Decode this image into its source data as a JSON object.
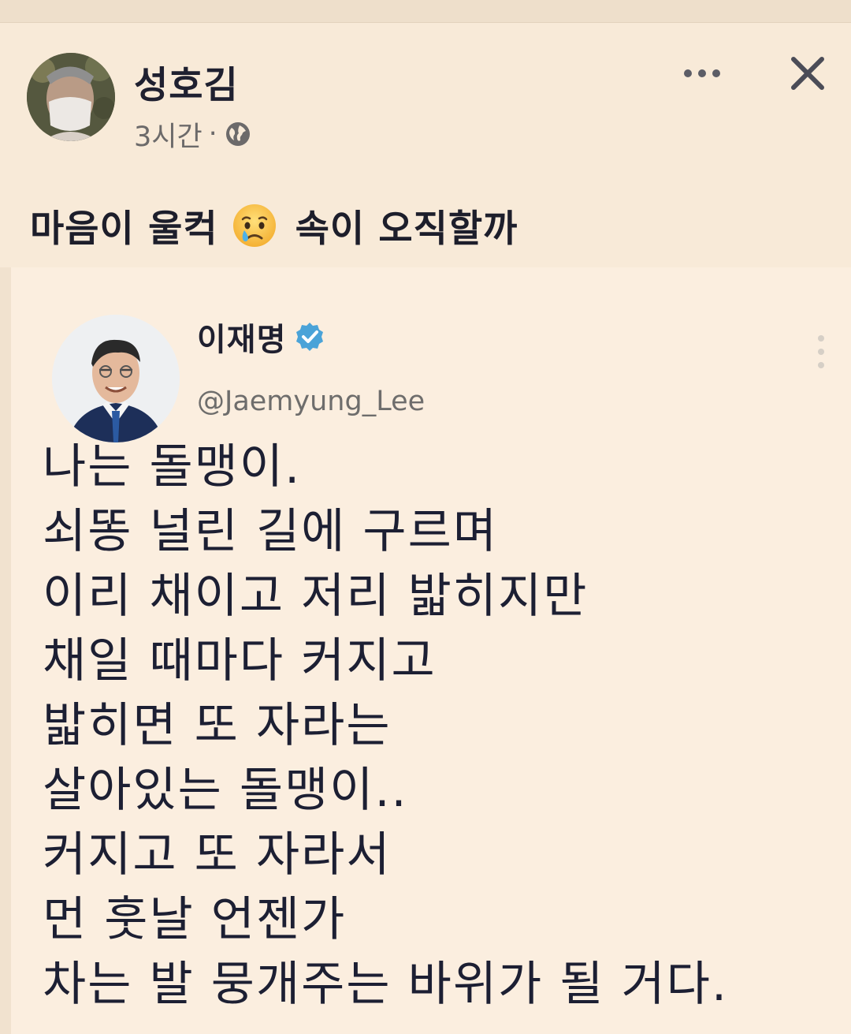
{
  "post": {
    "author": "성호김",
    "time": "3시간",
    "separator": "·",
    "text_before_emoji": "마음이 울컥",
    "text_after_emoji": "속이 오직할까"
  },
  "tweet": {
    "name": "이재명",
    "handle": "@Jaemyung_Lee",
    "lines": [
      "나는 돌맹이.",
      "쇠똥 널린 길에 구르며",
      "이리 채이고 저리 밟히지만",
      "채일 때마다 커지고",
      "밟히면 또 자라는",
      "살아있는 돌맹이..",
      "커지고 또 자라서",
      "먼 훗날 언젠가",
      "차는 발 뭉개주는 바위가 될 거다."
    ]
  },
  "icons": {
    "globe": "globe-icon",
    "more": "more-horizontal-icon",
    "close": "close-icon",
    "emoji": "crying-face-emoji",
    "verified": "verified-badge-icon",
    "tweet_menu": "more-vertical-icon"
  },
  "colors": {
    "background": "#f6e7d4",
    "verified": "#4aa3d8",
    "text": "#1c1f33"
  }
}
